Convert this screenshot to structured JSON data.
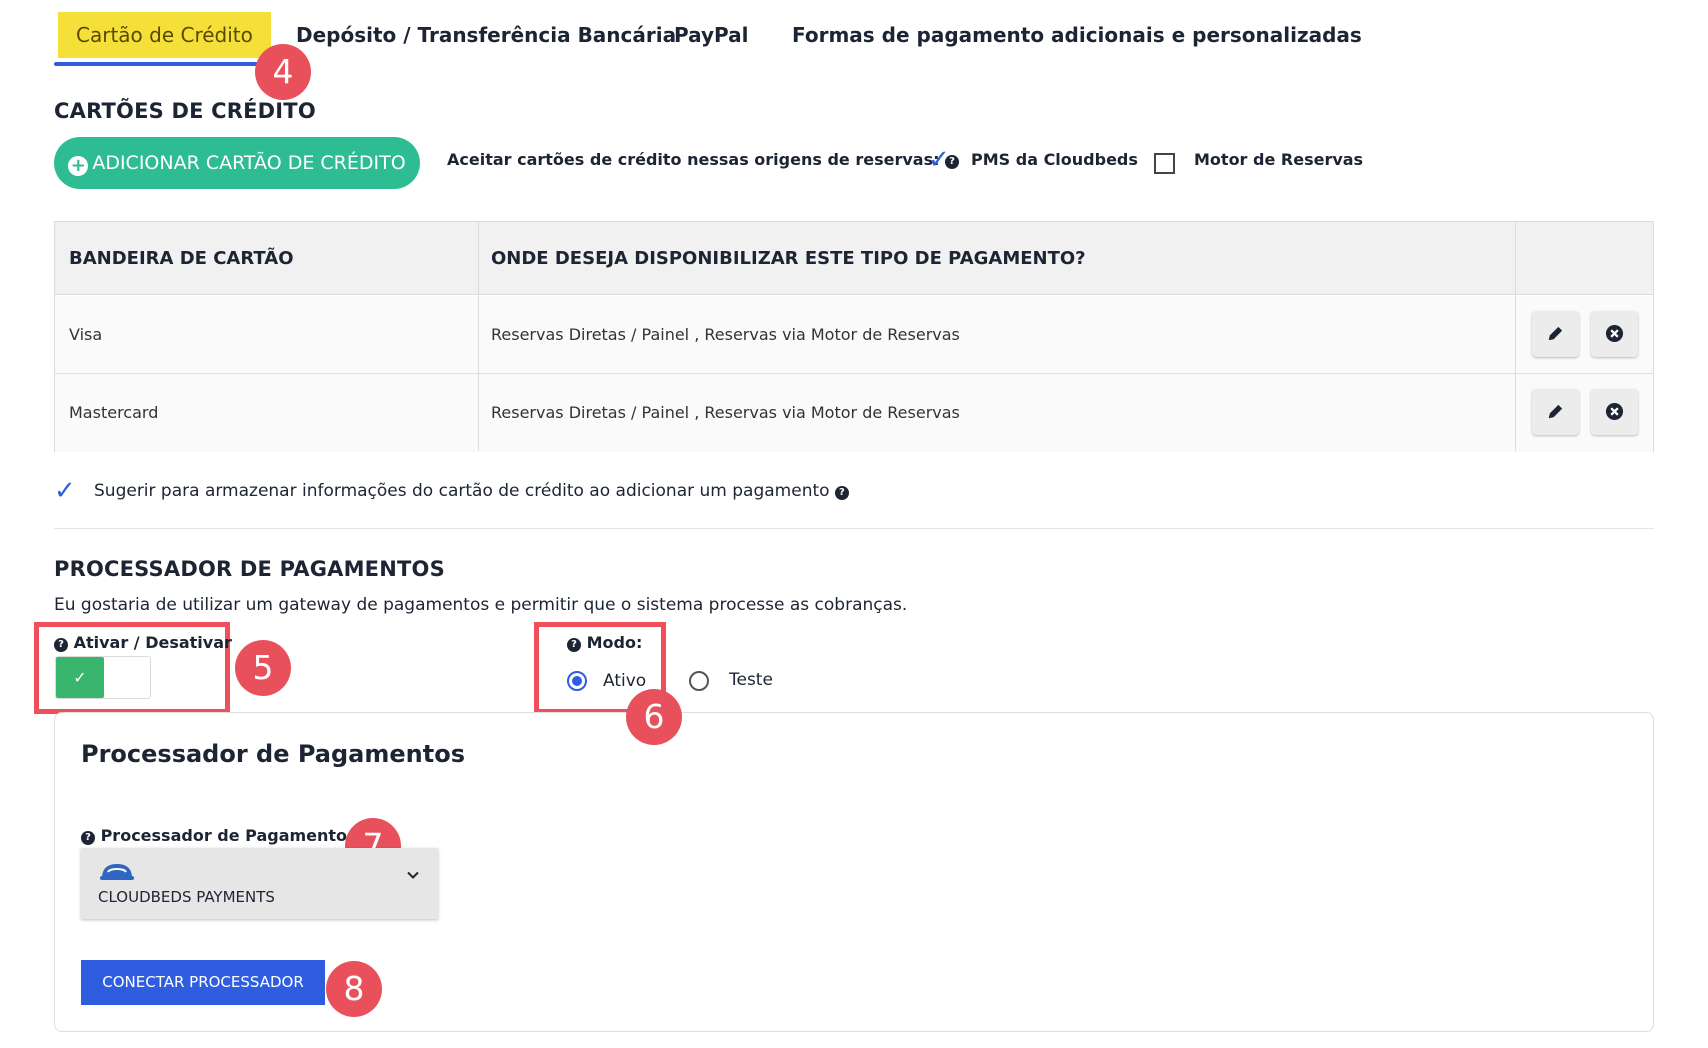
{
  "tabs": [
    {
      "label": "Cartão de Crédito"
    },
    {
      "label": "Depósito / Transferência Bancária"
    },
    {
      "label": "PayPal"
    },
    {
      "label": "Formas de pagamento adicionais e personalizadas"
    }
  ],
  "badges": {
    "b4": "4",
    "b5": "5",
    "b6": "6",
    "b7": "7",
    "b8": "8"
  },
  "credit_cards": {
    "heading": "CARTÕES DE CRÉDITO",
    "add_button": "ADICIONAR CARTÃO DE CRÉDITO",
    "accept_label": "Aceitar cartões de crédito nessas origens de reservas:",
    "origins": [
      {
        "label": "PMS da Cloudbeds",
        "checked": true
      },
      {
        "label": "Motor de Reservas",
        "checked": false
      }
    ]
  },
  "table": {
    "headers": [
      "BANDEIRA DE CARTÃO",
      "ONDE DESEJA DISPONIBILIZAR ESTE TIPO DE PAGAMENTO?"
    ],
    "rows": [
      {
        "brand": "Visa",
        "where": "Reservas Diretas / Painel , Reservas via Motor de Reservas"
      },
      {
        "brand": "Mastercard",
        "where": "Reservas Diretas / Painel , Reservas via Motor de Reservas"
      }
    ]
  },
  "suggest_store": {
    "label": "Sugerir para armazenar informações do cartão de crédito ao adicionar um pagamento",
    "checked": true
  },
  "processor": {
    "heading": "PROCESSADOR DE PAGAMENTOS",
    "description": "Eu gostaria de utilizar um gateway de pagamentos e permitir que o sistema processe as cobranças.",
    "toggle_label": "Ativar / Desativar",
    "toggle_on": true,
    "mode_label": "Modo:",
    "modes": [
      {
        "label": "Ativo",
        "selected": true
      },
      {
        "label": "Teste",
        "selected": false
      }
    ],
    "panel_title": "Processador de Pagamentos",
    "select_label": "Processador de Pagamentos",
    "select_value": "CLOUDBEDS PAYMENTS",
    "connect_button": "CONECTAR PROCESSADOR"
  },
  "colors": {
    "accent": "#2f5de0",
    "tab_active": "#f5e03a",
    "green": "#2ebd93",
    "badge": "#e8505b",
    "highlight": "#ef4f5a"
  }
}
